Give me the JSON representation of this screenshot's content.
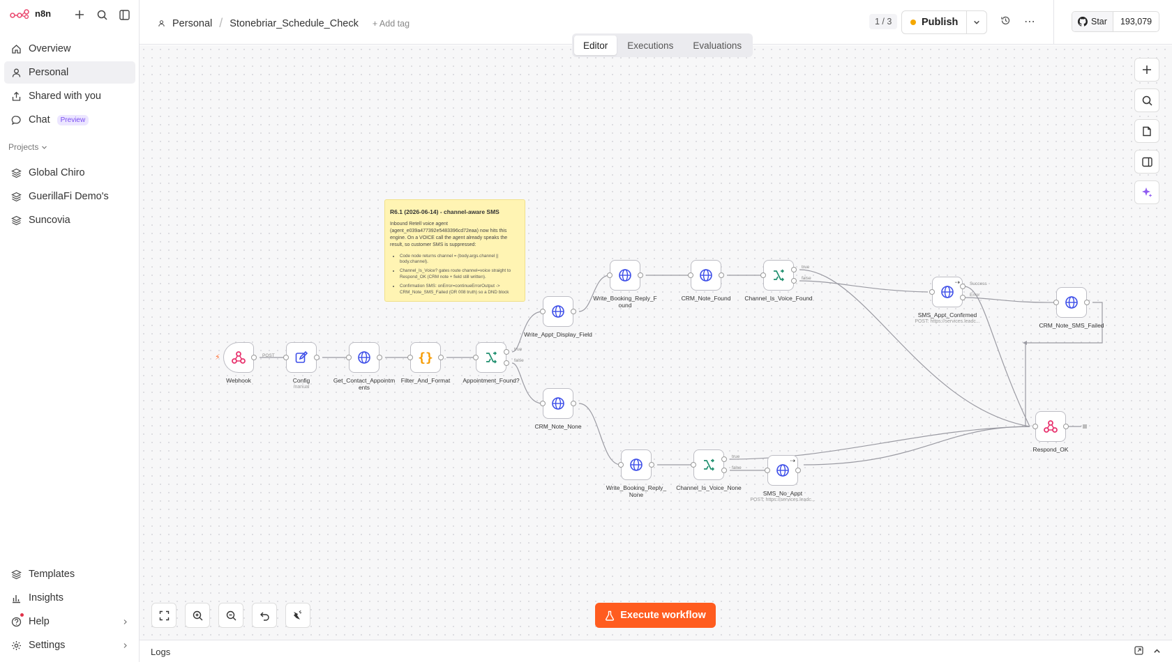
{
  "brand": {
    "name": "n8n"
  },
  "sidebar": {
    "nav": [
      {
        "label": "Overview",
        "icon": "home-icon"
      },
      {
        "label": "Personal",
        "icon": "user-icon"
      },
      {
        "label": "Shared with you",
        "icon": "share-icon"
      },
      {
        "label": "Chat",
        "icon": "chat-icon",
        "badge": "Preview"
      }
    ],
    "projects_label": "Projects",
    "projects": [
      "Global Chiro",
      "GuerillaFi Demo's",
      "Suncovia"
    ],
    "bottom": [
      {
        "label": "Templates"
      },
      {
        "label": "Insights"
      },
      {
        "label": "Help"
      },
      {
        "label": "Settings"
      }
    ]
  },
  "header": {
    "owner": "Personal",
    "workflow_name": "Stonebriar_Schedule_Check",
    "add_tag": "+ Add tag",
    "pager": "1 / 3",
    "publish_label": "Publish",
    "github_star": "Star",
    "github_count": "193,079"
  },
  "tabs": [
    "Editor",
    "Executions",
    "Evaluations"
  ],
  "sticky": {
    "title": "R6.1 (2026-06-14) - channel-aware SMS",
    "body": "Inbound Retell voice agent (agent_e039a477392e5483396cd72eaa) now hits this engine. On a VOICE call the agent already speaks the result, so customer SMS is suppressed:",
    "bullets": [
      "Code node returns channel = (body.args.channel || body.channel).",
      "Channel_Is_Voice? gates route channel=voice straight to Respond_OK (CRM note + field still written).",
      "Confirmation SMS: onError=continueErrorOutput -> CRM_Note_SMS_Failed (OR 008 truth) so a DND block"
    ]
  },
  "nodes": {
    "webhook": {
      "label": "Webhook",
      "port_label": "POST"
    },
    "config": {
      "label": "Config",
      "sub": "manual"
    },
    "get_contact": {
      "label": "Get_Contact_Appointments"
    },
    "filter": {
      "label": "Filter_And_Format"
    },
    "appt_found": {
      "label": "Appointment_Found?",
      "true_label": "true",
      "false_label": "false"
    },
    "write_display": {
      "label": "Write_Appt_Display_Field"
    },
    "crm_none": {
      "label": "CRM_Note_None"
    },
    "write_reply_found": {
      "label": "Write_Booking_Reply_Found"
    },
    "crm_found": {
      "label": "CRM_Note_Found"
    },
    "voice_found": {
      "label": "Channel_Is_Voice_Found",
      "true_label": "true",
      "false_label": "false"
    },
    "sms_confirmed": {
      "label": "SMS_Appt_Confirmed",
      "sub": "POST: https://services.leadc...",
      "success_label": "Success",
      "error_label": "Error"
    },
    "crm_sms_failed": {
      "label": "CRM_Note_SMS_Failed"
    },
    "respond_ok": {
      "label": "Respond_OK"
    },
    "write_reply_none": {
      "label": "Write_Booking_Reply_None"
    },
    "voice_none": {
      "label": "Channel_Is_Voice_None",
      "true_label": "true",
      "false_label": "false"
    },
    "sms_no_appt": {
      "label": "SMS_No_Appt",
      "sub": "POST: https://services.leadc..."
    }
  },
  "execute_label": "Execute workflow",
  "logs_label": "Logs",
  "colors": {
    "accent": "#ff5c1f",
    "http": "#3d4ee8",
    "webhook": "#e8336e",
    "ifnode": "#1f8f6e",
    "code": "#f59a00",
    "edit": "#3d4ee8"
  }
}
